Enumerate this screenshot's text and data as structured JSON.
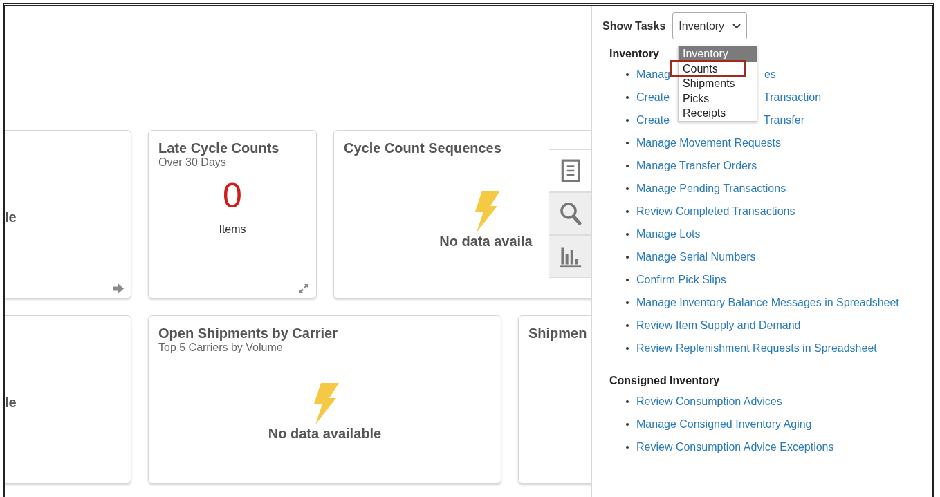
{
  "tile_rows": [
    [
      {
        "kind": "partial",
        "fragment": "le",
        "corner": {
          "kind": "arrow"
        }
      },
      {
        "kind": "metric",
        "title": "Late Cycle Counts",
        "subtitle": "Over 30 Days",
        "value": "0",
        "unit": "Items",
        "corner": {
          "kind": "expand"
        }
      },
      {
        "kind": "empty",
        "title": "Cycle Count Sequences",
        "message": "No data availa"
      }
    ],
    [
      {
        "kind": "partial",
        "fragment": "le"
      },
      {
        "kind": "empty",
        "title": "Open Shipments by Carrier",
        "subtitle": "Top 5 Carriers by Volume",
        "message": "No data available"
      },
      {
        "kind": "title",
        "title": "Shipmen"
      }
    ]
  ],
  "side_tabs": [
    {
      "kind": "document",
      "selected": true
    },
    {
      "kind": "search",
      "selected": false
    },
    {
      "kind": "chart",
      "selected": false
    }
  ],
  "task_panel": {
    "label": "Show Tasks",
    "select": {
      "value": "Inventory"
    },
    "options": [
      {
        "label": "Inventory",
        "selected": true,
        "highlighted": false
      },
      {
        "label": "Counts",
        "selected": false,
        "highlighted": true
      },
      {
        "label": "Shipments",
        "selected": false,
        "highlighted": false
      },
      {
        "label": "Picks",
        "selected": false,
        "highlighted": false
      },
      {
        "label": "Receipts",
        "selected": false,
        "highlighted": false
      }
    ],
    "sections": [
      {
        "title": "Inventory",
        "links": [
          {
            "text": "Manag",
            "text_after": "es"
          },
          {
            "text": "Create",
            "text_after": "Transaction"
          },
          {
            "text": "Create",
            "text_after": "Transfer"
          },
          {
            "text": "Manage Movement Requests"
          },
          {
            "text": "Manage Transfer Orders"
          },
          {
            "text": "Manage Pending Transactions"
          },
          {
            "text": "Review Completed Transactions"
          },
          {
            "text": "Manage Lots"
          },
          {
            "text": "Manage Serial Numbers"
          },
          {
            "text": "Confirm Pick Slips"
          },
          {
            "text": "Manage Inventory Balance Messages in Spreadsheet"
          },
          {
            "text": "Review Item Supply and Demand"
          },
          {
            "text": "Review Replenishment Requests in Spreadsheet"
          }
        ]
      },
      {
        "title": "Consigned Inventory",
        "links": [
          {
            "text": "Review Consumption Advices"
          },
          {
            "text": "Manage Consigned Inventory Aging"
          },
          {
            "text": "Review Consumption Advice Exceptions"
          }
        ]
      }
    ]
  }
}
